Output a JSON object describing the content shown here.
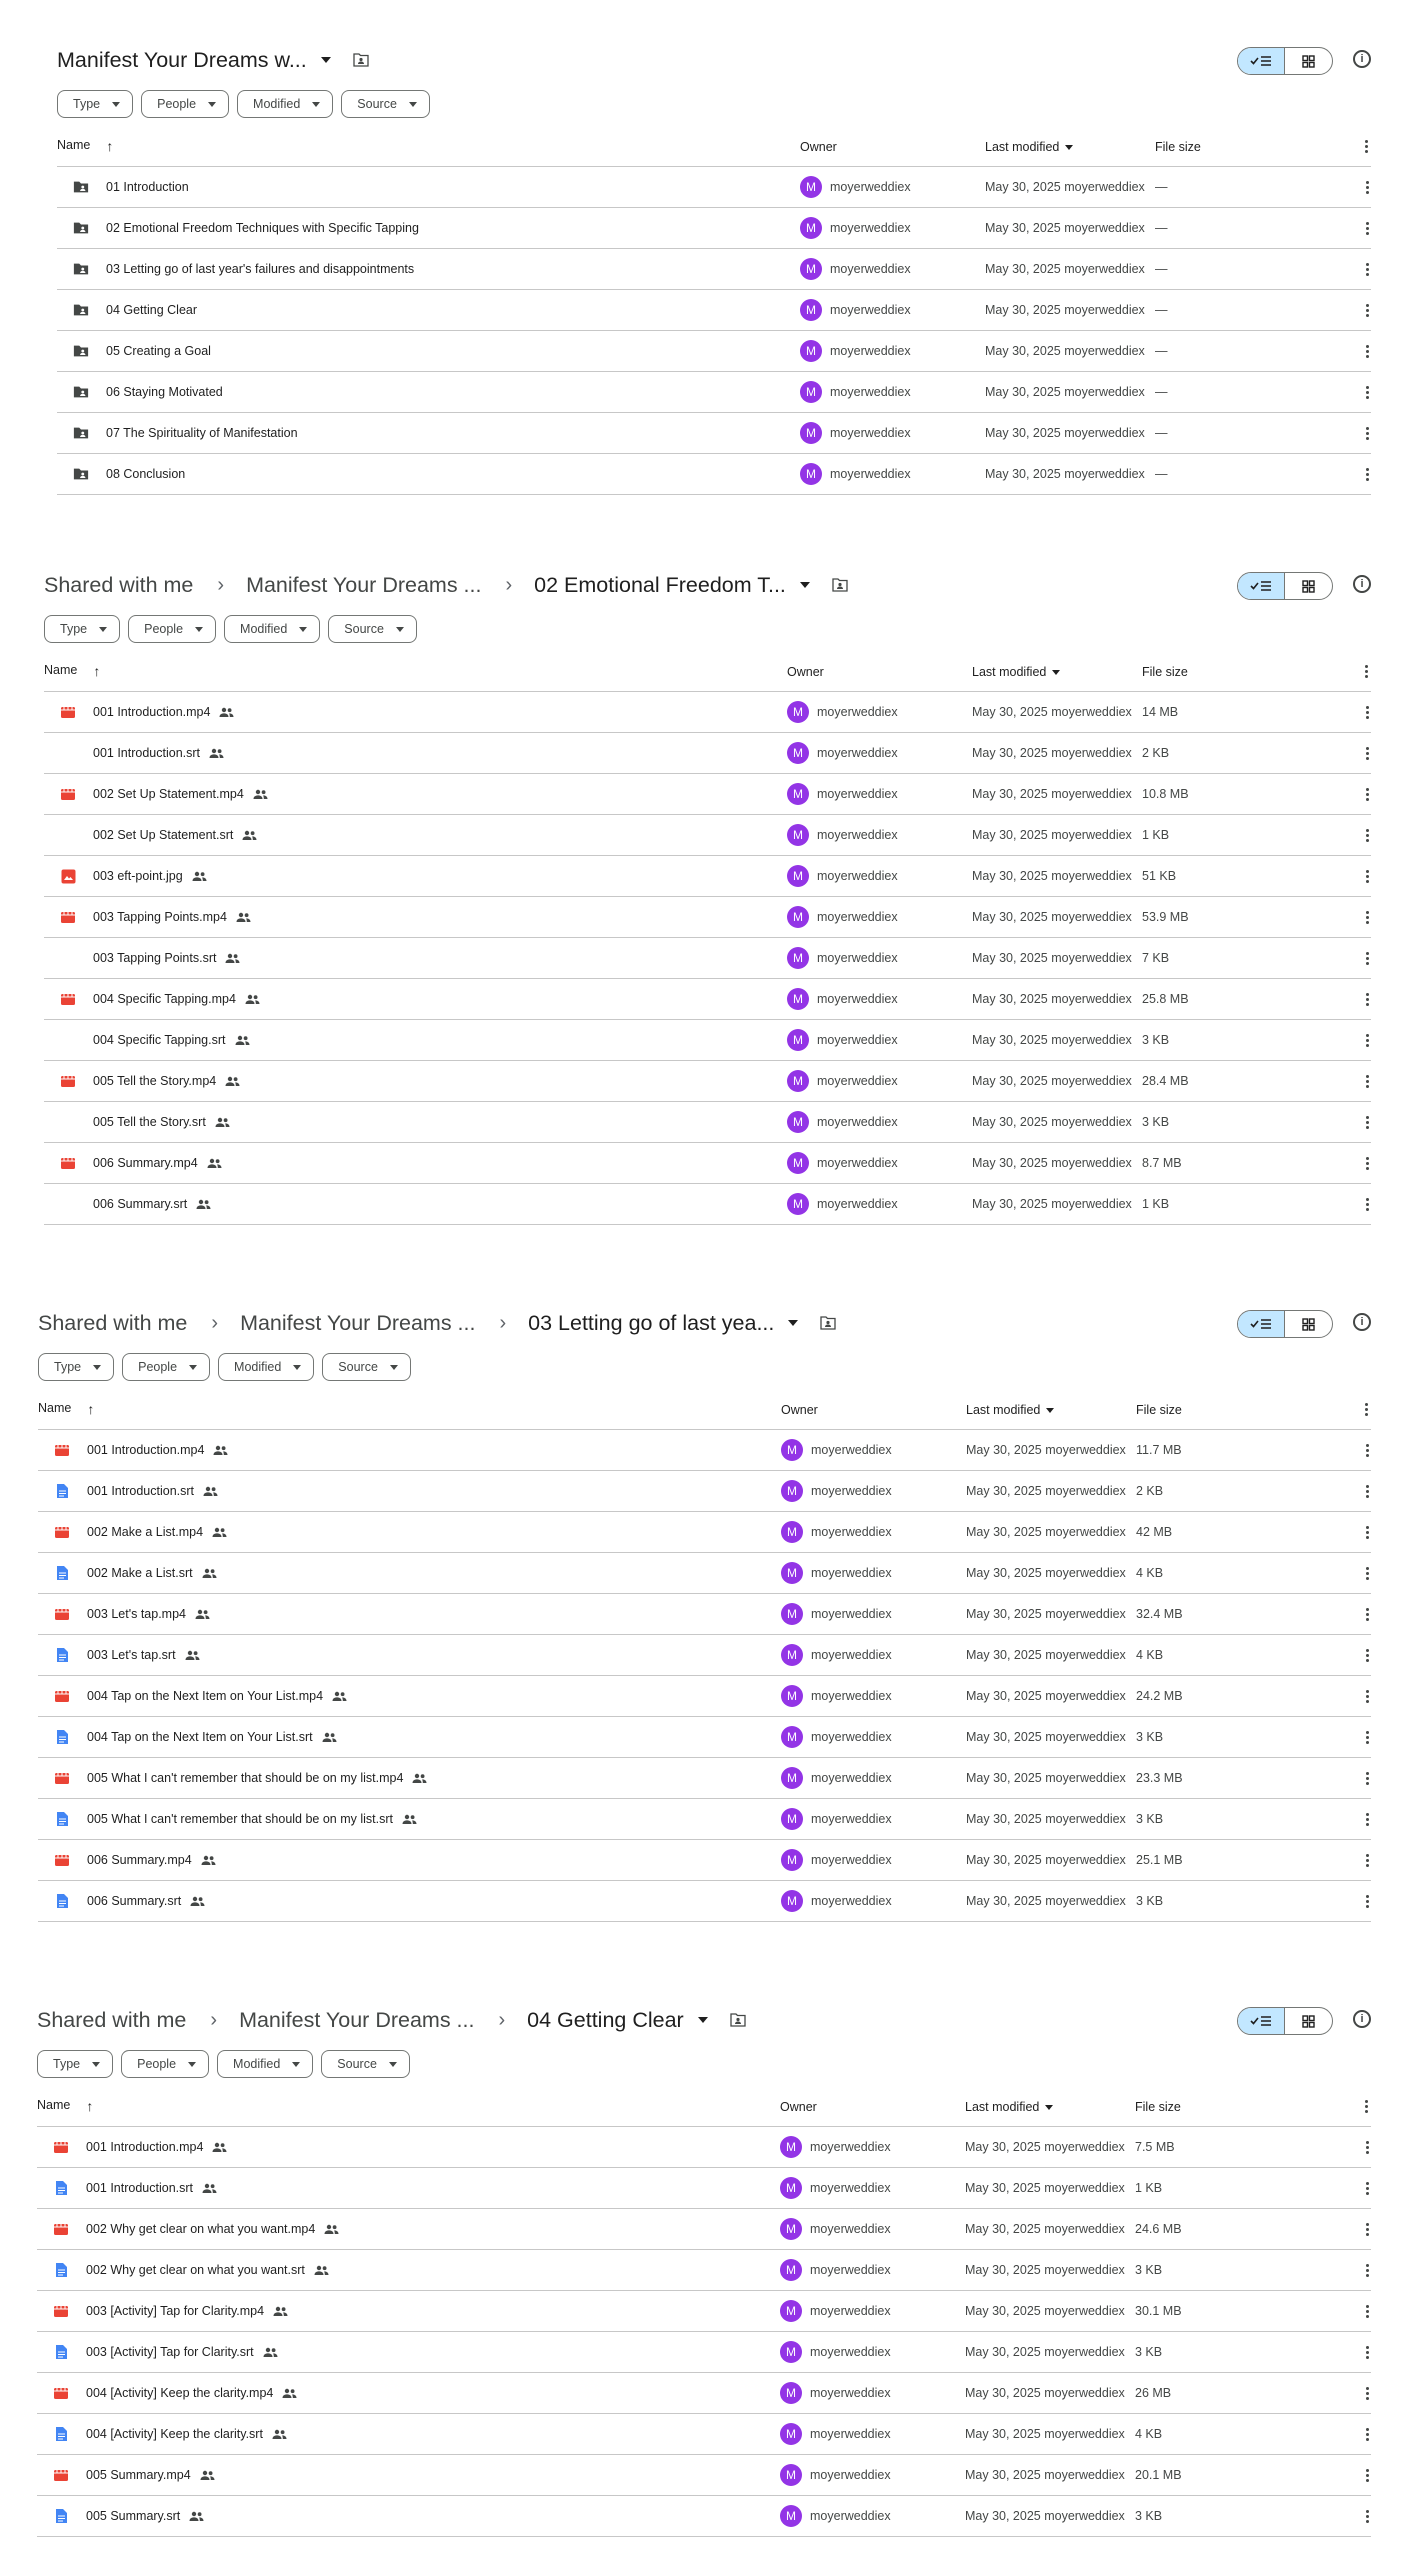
{
  "colors": {
    "accent": "#c2e7ff",
    "avatar": "#9334e6",
    "video_icon": "#ea4335",
    "doc_icon": "#4285f4",
    "divider": "#c7c7c7"
  },
  "shared_crumb": "Shared with me",
  "filters": {
    "type": "Type",
    "people": "People",
    "modified": "Modified",
    "source": "Source"
  },
  "columns": {
    "name": "Name",
    "owner": "Owner",
    "modified": "Last modified",
    "size": "File size"
  },
  "info_icon": "i",
  "panels": [
    {
      "breadcrumb": [
        "Manifest Your Dreams w..."
      ],
      "rows": [
        {
          "icon": "shared-folder-icon",
          "name": "01 Introduction",
          "shared": false,
          "owner": "moyerweddiex",
          "modified": "May 30, 2025 moyerweddiex",
          "size": "—"
        },
        {
          "icon": "shared-folder-icon",
          "name": "02 Emotional Freedom Techniques with Specific Tapping",
          "shared": false,
          "owner": "moyerweddiex",
          "modified": "May 30, 2025 moyerweddiex",
          "size": "—"
        },
        {
          "icon": "shared-folder-icon",
          "name": "03 Letting go of last year's failures and disappointments",
          "shared": false,
          "owner": "moyerweddiex",
          "modified": "May 30, 2025 moyerweddiex",
          "size": "—"
        },
        {
          "icon": "shared-folder-icon",
          "name": "04 Getting Clear",
          "shared": false,
          "owner": "moyerweddiex",
          "modified": "May 30, 2025 moyerweddiex",
          "size": "—"
        },
        {
          "icon": "shared-folder-icon",
          "name": "05 Creating a Goal",
          "shared": false,
          "owner": "moyerweddiex",
          "modified": "May 30, 2025 moyerweddiex",
          "size": "—"
        },
        {
          "icon": "shared-folder-icon",
          "name": "06 Staying Motivated",
          "shared": false,
          "owner": "moyerweddiex",
          "modified": "May 30, 2025 moyerweddiex",
          "size": "—"
        },
        {
          "icon": "shared-folder-icon",
          "name": "07 The Spirituality of Manifestation",
          "shared": false,
          "owner": "moyerweddiex",
          "modified": "May 30, 2025 moyerweddiex",
          "size": "—"
        },
        {
          "icon": "shared-folder-icon",
          "name": "08 Conclusion",
          "shared": false,
          "owner": "moyerweddiex",
          "modified": "May 30, 2025 moyerweddiex",
          "size": "—"
        }
      ]
    },
    {
      "breadcrumb": [
        "Shared with me",
        "Manifest Your Dreams ...",
        "02 Emotional Freedom T..."
      ],
      "rows": [
        {
          "icon": "video-icon",
          "name": "001 Introduction.mp4",
          "shared": true,
          "owner": "moyerweddiex",
          "modified": "May 30, 2025 moyerweddiex",
          "size": "14 MB"
        },
        {
          "icon": "none",
          "name": "001 Introduction.srt",
          "shared": true,
          "owner": "moyerweddiex",
          "modified": "May 30, 2025 moyerweddiex",
          "size": "2 KB"
        },
        {
          "icon": "video-icon",
          "name": "002 Set Up Statement.mp4",
          "shared": true,
          "owner": "moyerweddiex",
          "modified": "May 30, 2025 moyerweddiex",
          "size": "10.8 MB"
        },
        {
          "icon": "none",
          "name": "002 Set Up Statement.srt",
          "shared": true,
          "owner": "moyerweddiex",
          "modified": "May 30, 2025 moyerweddiex",
          "size": "1 KB"
        },
        {
          "icon": "image-icon",
          "name": "003 eft-point.jpg",
          "shared": true,
          "owner": "moyerweddiex",
          "modified": "May 30, 2025 moyerweddiex",
          "size": "51 KB"
        },
        {
          "icon": "video-icon",
          "name": "003 Tapping Points.mp4",
          "shared": true,
          "owner": "moyerweddiex",
          "modified": "May 30, 2025 moyerweddiex",
          "size": "53.9 MB"
        },
        {
          "icon": "none",
          "name": "003 Tapping Points.srt",
          "shared": true,
          "owner": "moyerweddiex",
          "modified": "May 30, 2025 moyerweddiex",
          "size": "7 KB"
        },
        {
          "icon": "video-icon",
          "name": "004 Specific Tapping.mp4",
          "shared": true,
          "owner": "moyerweddiex",
          "modified": "May 30, 2025 moyerweddiex",
          "size": "25.8 MB"
        },
        {
          "icon": "none",
          "name": "004 Specific Tapping.srt",
          "shared": true,
          "owner": "moyerweddiex",
          "modified": "May 30, 2025 moyerweddiex",
          "size": "3 KB"
        },
        {
          "icon": "video-icon",
          "name": "005 Tell the Story.mp4",
          "shared": true,
          "owner": "moyerweddiex",
          "modified": "May 30, 2025 moyerweddiex",
          "size": "28.4 MB"
        },
        {
          "icon": "none",
          "name": "005 Tell the Story.srt",
          "shared": true,
          "owner": "moyerweddiex",
          "modified": "May 30, 2025 moyerweddiex",
          "size": "3 KB"
        },
        {
          "icon": "video-icon",
          "name": "006 Summary.mp4",
          "shared": true,
          "owner": "moyerweddiex",
          "modified": "May 30, 2025 moyerweddiex",
          "size": "8.7 MB"
        },
        {
          "icon": "none",
          "name": "006 Summary.srt",
          "shared": true,
          "owner": "moyerweddiex",
          "modified": "May 30, 2025 moyerweddiex",
          "size": "1 KB"
        }
      ]
    },
    {
      "breadcrumb": [
        "Shared with me",
        "Manifest Your Dreams ...",
        "03 Letting go of last yea..."
      ],
      "rows": [
        {
          "icon": "video-icon",
          "name": "001 Introduction.mp4",
          "shared": true,
          "owner": "moyerweddiex",
          "modified": "May 30, 2025 moyerweddiex",
          "size": "11.7 MB"
        },
        {
          "icon": "doc-icon",
          "name": "001 Introduction.srt",
          "shared": true,
          "owner": "moyerweddiex",
          "modified": "May 30, 2025 moyerweddiex",
          "size": "2 KB"
        },
        {
          "icon": "video-icon",
          "name": "002 Make a List.mp4",
          "shared": true,
          "owner": "moyerweddiex",
          "modified": "May 30, 2025 moyerweddiex",
          "size": "42 MB"
        },
        {
          "icon": "doc-icon",
          "name": "002 Make a List.srt",
          "shared": true,
          "owner": "moyerweddiex",
          "modified": "May 30, 2025 moyerweddiex",
          "size": "4 KB"
        },
        {
          "icon": "video-icon",
          "name": "003 Let's tap.mp4",
          "shared": true,
          "owner": "moyerweddiex",
          "modified": "May 30, 2025 moyerweddiex",
          "size": "32.4 MB"
        },
        {
          "icon": "doc-icon",
          "name": "003 Let's tap.srt",
          "shared": true,
          "owner": "moyerweddiex",
          "modified": "May 30, 2025 moyerweddiex",
          "size": "4 KB"
        },
        {
          "icon": "video-icon",
          "name": "004 Tap on the Next Item on Your List.mp4",
          "shared": true,
          "owner": "moyerweddiex",
          "modified": "May 30, 2025 moyerweddiex",
          "size": "24.2 MB"
        },
        {
          "icon": "doc-icon",
          "name": "004 Tap on the Next Item on Your List.srt",
          "shared": true,
          "owner": "moyerweddiex",
          "modified": "May 30, 2025 moyerweddiex",
          "size": "3 KB"
        },
        {
          "icon": "video-icon",
          "name": "005 What I can't remember that should be on my list.mp4",
          "shared": true,
          "owner": "moyerweddiex",
          "modified": "May 30, 2025 moyerweddiex",
          "size": "23.3 MB"
        },
        {
          "icon": "doc-icon",
          "name": "005 What I can't remember that should be on my list.srt",
          "shared": true,
          "owner": "moyerweddiex",
          "modified": "May 30, 2025 moyerweddiex",
          "size": "3 KB"
        },
        {
          "icon": "video-icon",
          "name": "006 Summary.mp4",
          "shared": true,
          "owner": "moyerweddiex",
          "modified": "May 30, 2025 moyerweddiex",
          "size": "25.1 MB"
        },
        {
          "icon": "doc-icon",
          "name": "006 Summary.srt",
          "shared": true,
          "owner": "moyerweddiex",
          "modified": "May 30, 2025 moyerweddiex",
          "size": "3 KB"
        }
      ]
    },
    {
      "breadcrumb": [
        "Shared with me",
        "Manifest Your Dreams ...",
        "04 Getting Clear"
      ],
      "rows": [
        {
          "icon": "video-icon",
          "name": "001 Introduction.mp4",
          "shared": true,
          "owner": "moyerweddiex",
          "modified": "May 30, 2025 moyerweddiex",
          "size": "7.5 MB"
        },
        {
          "icon": "doc-icon",
          "name": "001 Introduction.srt",
          "shared": true,
          "owner": "moyerweddiex",
          "modified": "May 30, 2025 moyerweddiex",
          "size": "1 KB"
        },
        {
          "icon": "video-icon",
          "name": "002 Why get clear on what you want.mp4",
          "shared": true,
          "owner": "moyerweddiex",
          "modified": "May 30, 2025 moyerweddiex",
          "size": "24.6 MB"
        },
        {
          "icon": "doc-icon",
          "name": "002 Why get clear on what you want.srt",
          "shared": true,
          "owner": "moyerweddiex",
          "modified": "May 30, 2025 moyerweddiex",
          "size": "3 KB"
        },
        {
          "icon": "video-icon",
          "name": "003 [Activity] Tap for Clarity.mp4",
          "shared": true,
          "owner": "moyerweddiex",
          "modified": "May 30, 2025 moyerweddiex",
          "size": "30.1 MB"
        },
        {
          "icon": "doc-icon",
          "name": "003 [Activity] Tap for Clarity.srt",
          "shared": true,
          "owner": "moyerweddiex",
          "modified": "May 30, 2025 moyerweddiex",
          "size": "3 KB"
        },
        {
          "icon": "video-icon",
          "name": "004 [Activity] Keep the clarity.mp4",
          "shared": true,
          "owner": "moyerweddiex",
          "modified": "May 30, 2025 moyerweddiex",
          "size": "26 MB"
        },
        {
          "icon": "doc-icon",
          "name": "004 [Activity] Keep the clarity.srt",
          "shared": true,
          "owner": "moyerweddiex",
          "modified": "May 30, 2025 moyerweddiex",
          "size": "4 KB"
        },
        {
          "icon": "video-icon",
          "name": "005 Summary.mp4",
          "shared": true,
          "owner": "moyerweddiex",
          "modified": "May 30, 2025 moyerweddiex",
          "size": "20.1 MB"
        },
        {
          "icon": "doc-icon",
          "name": "005 Summary.srt",
          "shared": true,
          "owner": "moyerweddiex",
          "modified": "May 30, 2025 moyerweddiex",
          "size": "3 KB"
        }
      ]
    }
  ]
}
